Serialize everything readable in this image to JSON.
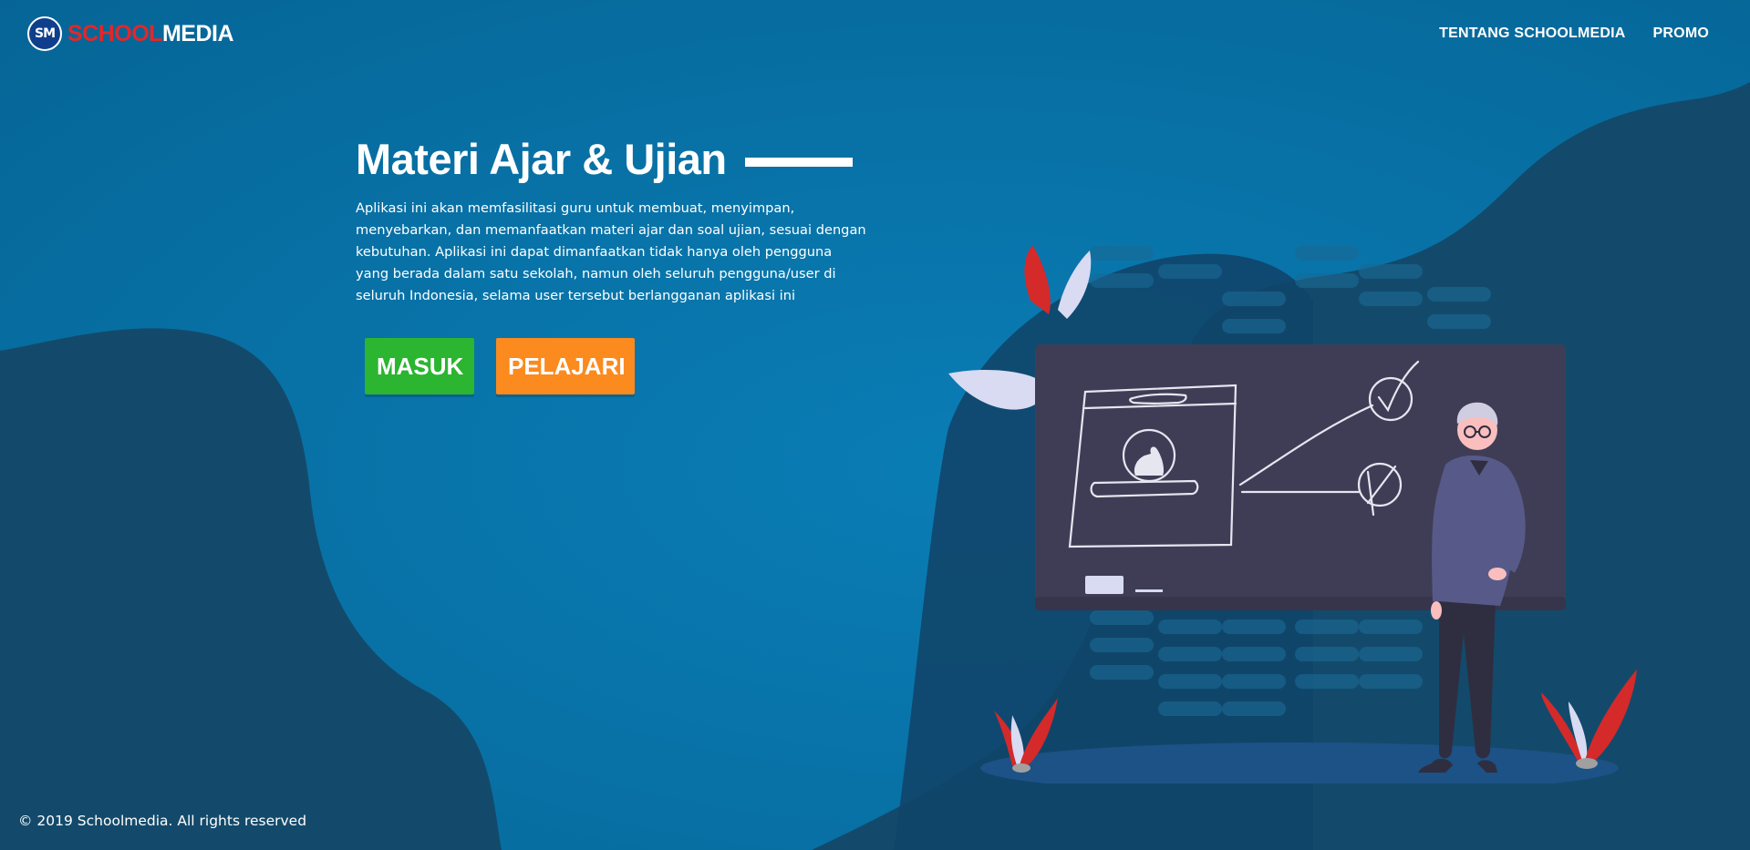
{
  "brand": {
    "logo_mark": "SM",
    "name_part1": "SCHOOL",
    "name_part2": "MEDIA"
  },
  "nav": {
    "items": [
      "TENTANG SCHOOLMEDIA",
      "PROMO"
    ]
  },
  "hero": {
    "title": "Materi Ajar & Ujian",
    "description": "Aplikasi ini akan memfasilitasi guru untuk membuat, menyimpan, menyebarkan, dan memanfaatkan materi ajar dan soal ujian, sesuai dengan kebutuhan. Aplikasi ini dapat dimanfaatkan tidak hanya oleh pengguna yang berada dalam satu sekolah, namun oleh seluruh pengguna/user di seluruh Indonesia, selama user tersebut berlangganan aplikasi ini",
    "buttons": {
      "login": "MASUK",
      "learn": "PELAJARI"
    }
  },
  "footer": {
    "copyright": "© 2019 Schoolmedia. All rights reserved"
  },
  "colors": {
    "background": "#0873a8",
    "dark_wave": "#134a6b",
    "brand_red": "#e0282a",
    "button_green": "#2bb530",
    "button_orange": "#fb8a1f",
    "board": "#3f3d56",
    "shirt": "#575a89"
  },
  "illustration": {
    "subject": "teacher-at-chalkboard",
    "icons": [
      "check-icon",
      "cross-icon",
      "profile-card-icon"
    ]
  }
}
